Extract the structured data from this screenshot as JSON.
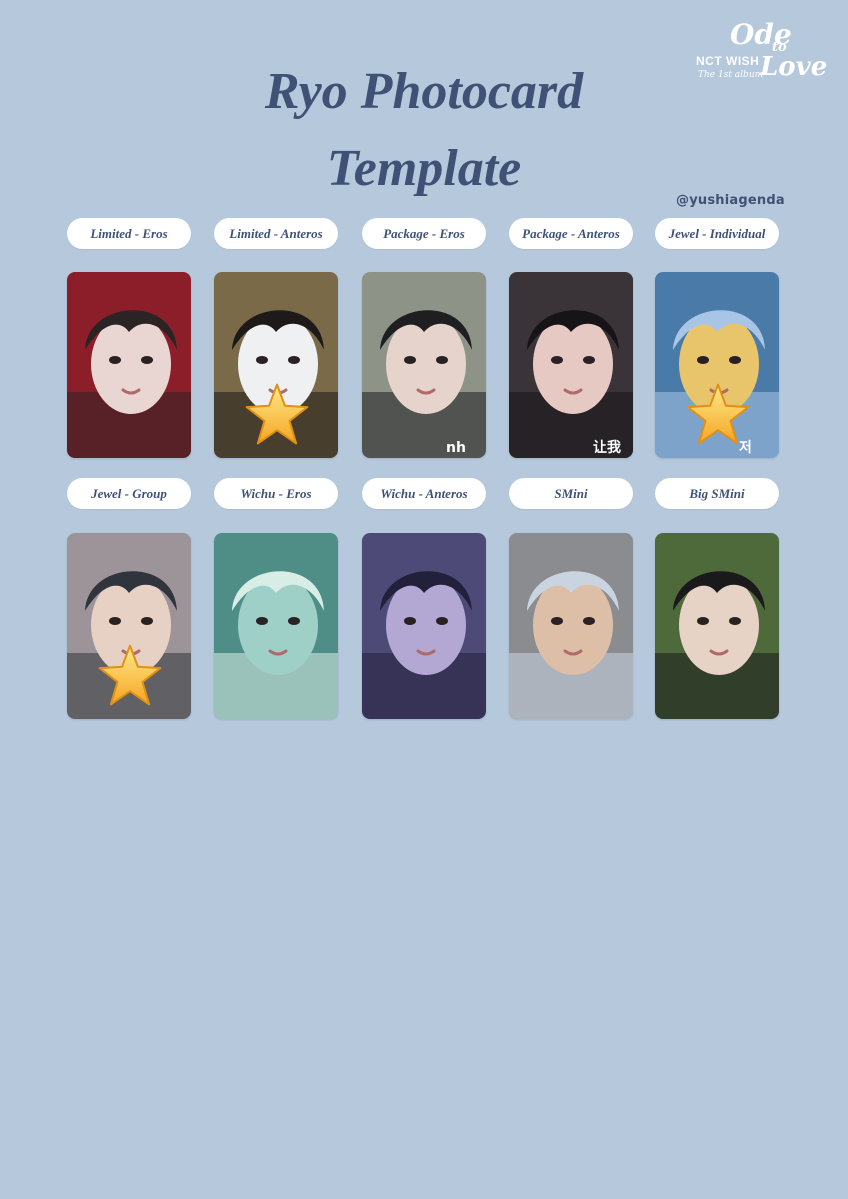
{
  "header": {
    "title_line1": "Ryo Photocard",
    "title_line2": "Template",
    "handle": "@yushiagenda"
  },
  "logo": {
    "brand": "NCT WISH",
    "subtitle": "The 1st album",
    "word1": "Ode",
    "word2": "to",
    "word3": "Love"
  },
  "cards": [
    {
      "label": "Limited - Eros",
      "starred": false,
      "palette": [
        "#8c1e2a",
        "#e9d6d2",
        "#2b2424"
      ],
      "overlay_text": ""
    },
    {
      "label": "Limited - Anteros",
      "starred": true,
      "palette": [
        "#7a6a48",
        "#eef0f2",
        "#1e1a1a"
      ],
      "overlay_text": ""
    },
    {
      "label": "Package - Eros",
      "starred": false,
      "palette": [
        "#8d9386",
        "#e6d3cc",
        "#1f1f22"
      ],
      "overlay_text": "nh"
    },
    {
      "label": "Package - Anteros",
      "starred": false,
      "palette": [
        "#3a3438",
        "#e7c9c4",
        "#161416"
      ],
      "overlay_text": "让我"
    },
    {
      "label": "Jewel - Individual",
      "starred": true,
      "palette": [
        "#4a7aa8",
        "#e8c46a",
        "#a9c5e6"
      ],
      "overlay_text": "저"
    },
    {
      "label": "Jewel - Group",
      "starred": true,
      "palette": [
        "#9c9498",
        "#e6d1c4",
        "#30343c"
      ],
      "overlay_text": ""
    },
    {
      "label": "Wichu - Eros",
      "starred": false,
      "palette": [
        "#4e8e86",
        "#9fd0c8",
        "#d8ede6"
      ],
      "overlay_text": ""
    },
    {
      "label": "Wichu - Anteros",
      "starred": false,
      "palette": [
        "#4e4a78",
        "#b3a8d4",
        "#22203a"
      ],
      "overlay_text": ""
    },
    {
      "label": "SMini",
      "starred": false,
      "palette": [
        "#8b8c90",
        "#ddbfa8",
        "#c9d4e0"
      ],
      "overlay_text": ""
    },
    {
      "label": "Big SMini",
      "starred": false,
      "palette": [
        "#4f6a3a",
        "#e7d2c6",
        "#1a1a1c"
      ],
      "overlay_text": ""
    }
  ]
}
